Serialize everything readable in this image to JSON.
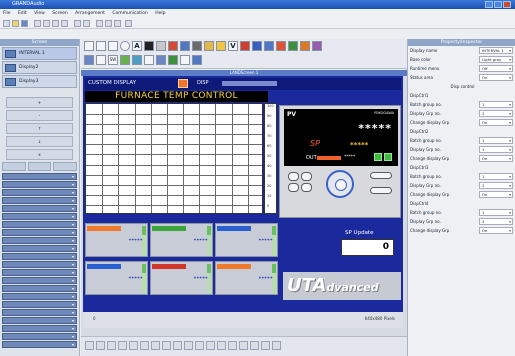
{
  "window": {
    "title": "GRANDAudio"
  },
  "menu": [
    "File",
    "Edit",
    "View",
    "Screen",
    "Arrangement",
    "Communication",
    "Help"
  ],
  "left_panel": {
    "header": "Screen",
    "items": [
      {
        "label": "INTERVAL 1",
        "selected": true
      },
      {
        "label": "Display2",
        "selected": false
      },
      {
        "label": "Display3",
        "selected": false
      }
    ],
    "buttons": [
      "+",
      "-",
      "↑",
      "↓",
      "x"
    ],
    "dropdown_count": 22
  },
  "canvas": {
    "doc_title": "LANDScreen 1",
    "custom_display_label": "CUSTOM DISPLAY",
    "disp_label": "DISP",
    "furnace_title": "FURNACE TEMP CONTROL",
    "scale_labels": [
      "100",
      "90",
      "80",
      "70",
      "60",
      "50",
      "40",
      "30",
      "20",
      "10",
      "0"
    ],
    "meter": {
      "pv_label": "PV",
      "brand": "YOKOGAWA",
      "pv_value": "*****",
      "sp_label": "SP",
      "sp_value": "*****",
      "out_label": "OUT",
      "out_value": "*****"
    },
    "tiles": [
      {
        "value": "*****",
        "band_color": "#f07a2a"
      },
      {
        "value": "*****",
        "band_color": "#3aa63a"
      },
      {
        "value": "*****",
        "band_color": "#2a5fd0"
      },
      {
        "value": "*****",
        "band_color": "#2a5fd0"
      },
      {
        "value": "*****",
        "band_color": "#d0342a"
      },
      {
        "value": "*****",
        "band_color": "#f07a2a"
      }
    ],
    "sp_update_label": "SP Update",
    "sp_update_value": "0",
    "logo_main": "UTA",
    "logo_suffix": "dvanced",
    "footer_left": "0",
    "footer_right": "640x480 Pixels"
  },
  "props": {
    "header": "Property/Inspector",
    "rows": [
      {
        "label": "Display name",
        "value": "INTERVAL 1"
      },
      {
        "label": "Base color",
        "value": "Light gray"
      },
      {
        "label": "Runtime menu",
        "value": "Off"
      },
      {
        "label": "Status area",
        "value": "On"
      }
    ],
    "section_header": "Disp control",
    "groups": [
      {
        "name": "DispCtrl1",
        "rows": [
          {
            "label": "Batch group no.",
            "value": "1"
          },
          {
            "label": "Display Grp no.",
            "value": "2"
          },
          {
            "label": "Change display Grp",
            "value": "On"
          }
        ]
      },
      {
        "name": "DispCtrl2",
        "rows": [
          {
            "label": "Batch group no.",
            "value": "1"
          },
          {
            "label": "Display Grp no.",
            "value": "1"
          },
          {
            "label": "Change display Grp",
            "value": "On"
          }
        ]
      },
      {
        "name": "DispCtrl3",
        "rows": [
          {
            "label": "Batch group no.",
            "value": "1"
          },
          {
            "label": "Display Grp no.",
            "value": "2"
          },
          {
            "label": "Change display Grp",
            "value": "On"
          }
        ]
      },
      {
        "name": "DispCtrl4",
        "rows": [
          {
            "label": "Batch group no.",
            "value": "1"
          },
          {
            "label": "Display Grp no.",
            "value": "2"
          },
          {
            "label": "Change display Grp",
            "value": "On"
          }
        ]
      }
    ]
  }
}
